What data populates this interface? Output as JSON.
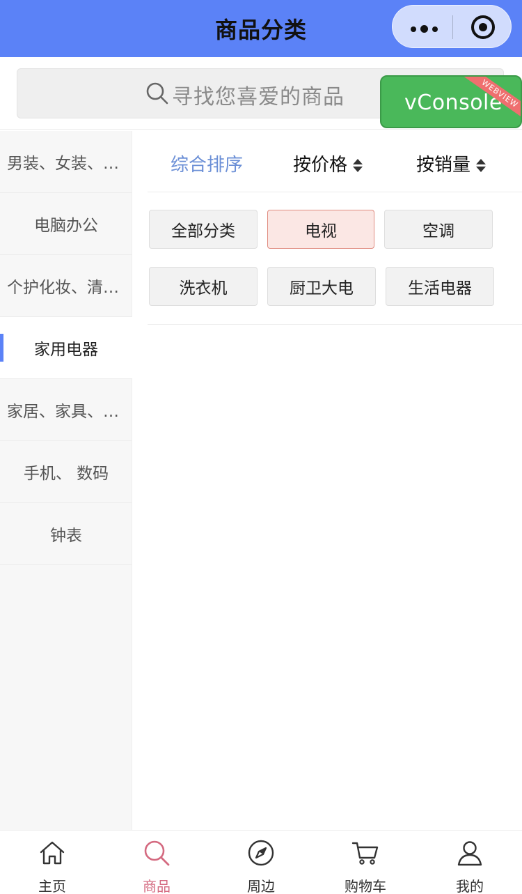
{
  "header": {
    "title": "商品分类"
  },
  "search": {
    "placeholder": "寻找您喜爱的商品"
  },
  "vconsole": {
    "label": "vConsole",
    "ribbon": "WEBVIEW"
  },
  "sidebar": {
    "items": [
      {
        "label": "男装、女装、内衣"
      },
      {
        "label": "电脑办公"
      },
      {
        "label": "个护化妆、清洁用品"
      },
      {
        "label": "家用电器",
        "active": true
      },
      {
        "label": "家居、家具、家装"
      },
      {
        "label": "手机、 数码"
      },
      {
        "label": "钟表"
      }
    ]
  },
  "sort": {
    "options": [
      {
        "label": "综合排序",
        "active": true
      },
      {
        "label": "按价格"
      },
      {
        "label": "按销量"
      }
    ]
  },
  "subcategories": [
    {
      "label": "全部分类"
    },
    {
      "label": "电视",
      "selected": true
    },
    {
      "label": "空调"
    },
    {
      "label": "洗衣机"
    },
    {
      "label": "厨卫大电"
    },
    {
      "label": "生活电器"
    }
  ],
  "tabbar": {
    "items": [
      {
        "label": "主页",
        "icon": "home-icon"
      },
      {
        "label": "商品",
        "icon": "search-icon",
        "active": true
      },
      {
        "label": "周边",
        "icon": "compass-icon"
      },
      {
        "label": "购物车",
        "icon": "cart-icon"
      },
      {
        "label": "我的",
        "icon": "user-icon"
      }
    ]
  },
  "colors": {
    "accent": "#5b82f7",
    "active_tab": "#d46a80",
    "sort_active": "#6b8fd6",
    "vconsole": "#4ab85a"
  }
}
